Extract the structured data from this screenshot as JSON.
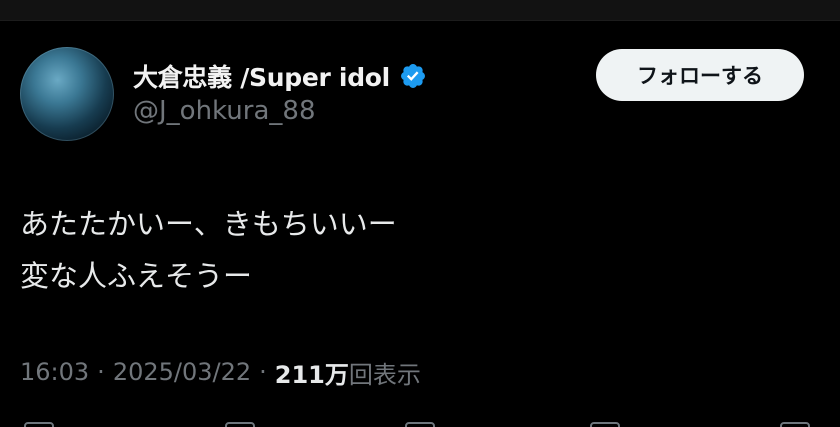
{
  "user": {
    "display_name": "大倉忠義 /Super idol",
    "handle": "@J_ohkura_88",
    "verified": true
  },
  "follow_button": {
    "label": "フォローする"
  },
  "tweet": {
    "lines": [
      "あたたかいー、きもちいいー",
      "変な人ふえそうー"
    ]
  },
  "meta": {
    "time": "16:03",
    "separator": "·",
    "date": "2025/03/22",
    "views_count": "211万",
    "views_label": "回表示"
  },
  "colors": {
    "background": "#000000",
    "text": "#e7e9ea",
    "muted": "#71767b",
    "verified_blue": "#1d9bf0",
    "button_bg": "#eff3f4"
  },
  "icons": {
    "avatar": "avatar-image",
    "verified": "verified-badge-icon"
  }
}
